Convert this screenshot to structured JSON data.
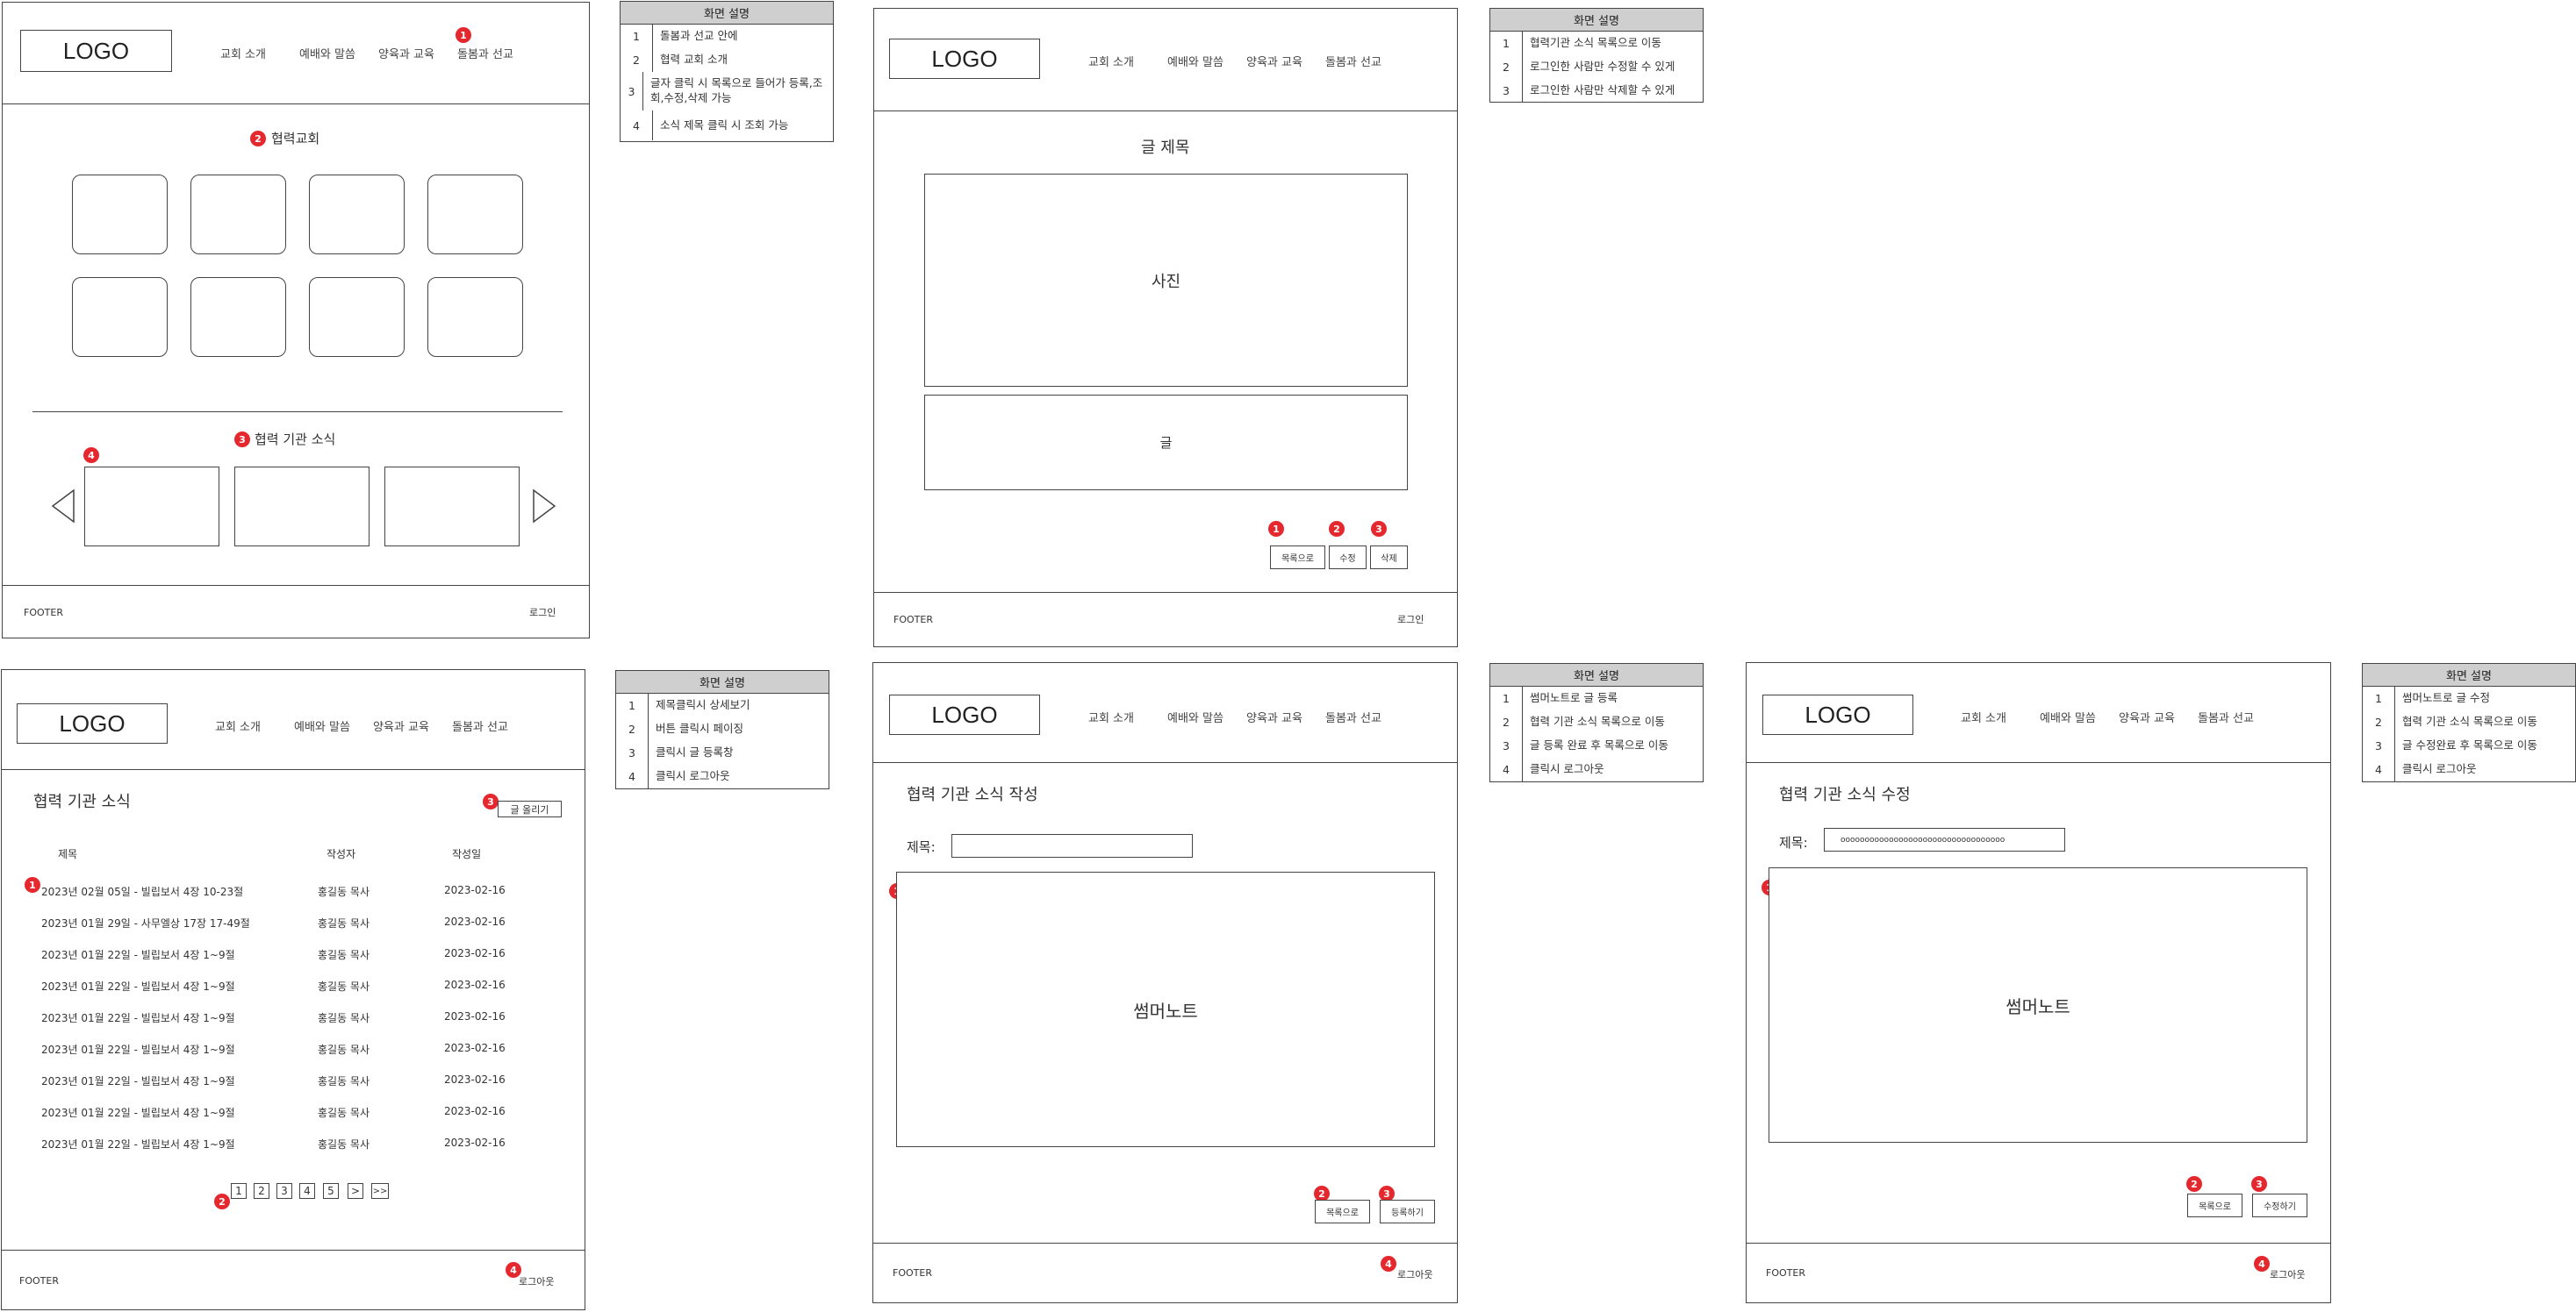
{
  "nav": {
    "about": "교회 소개",
    "worship": "예배와 말씀",
    "nurture": "양육과 교육",
    "mission": "돌봄과 선교"
  },
  "logo": "LOGO",
  "footer": {
    "label": "FOOTER",
    "login": "로그인",
    "logout": "로그아웃"
  },
  "badges": {
    "b1": "1",
    "b2": "2",
    "b3": "3",
    "b4": "4"
  },
  "screen1": {
    "section_partner": "협력교회",
    "section_news": "협력 기관 소식"
  },
  "desc_title": "화면 설명",
  "desc1": [
    {
      "n": "1",
      "t": "돌봄과 선교 안에"
    },
    {
      "n": "2",
      "t": "협력 교회 소개"
    },
    {
      "n": "3",
      "t": "글자 클릭 시 목록으로 들어가 등록,조회,수정,삭제 가능"
    },
    {
      "n": "4",
      "t": "소식 제목 클릭 시 조회 가능"
    }
  ],
  "screen2": {
    "post_title": "글 제목",
    "photo": "사진",
    "body": "글",
    "btn_list": "목록으로",
    "btn_edit": "수정",
    "btn_delete": "삭제"
  },
  "desc2": [
    {
      "n": "1",
      "t": "협력기관 소식 목록으로 이동"
    },
    {
      "n": "2",
      "t": "로그인한 사람만 수정할 수 있게"
    },
    {
      "n": "3",
      "t": "로그인한 사람만 삭제할 수 있게"
    }
  ],
  "screen3": {
    "page_title": "협력 기관 소식",
    "write_btn": "글 올리기",
    "col_title": "제목",
    "col_author": "작성자",
    "col_date": "작성일",
    "rows": [
      {
        "title": "2023년 02월 05일 - 빌립보서 4장 10-23절",
        "author": "홍길동 목사",
        "date": "2023-02-16"
      },
      {
        "title": "2023년 01월 29일 - 사무엘상 17장 17-49절",
        "author": "홍길동 목사",
        "date": "2023-02-16"
      },
      {
        "title": "2023년 01월 22일 - 빌립보서 4장 1~9절",
        "author": "홍길동 목사",
        "date": "2023-02-16"
      },
      {
        "title": "2023년 01월 22일 - 빌립보서 4장 1~9절",
        "author": "홍길동 목사",
        "date": "2023-02-16"
      },
      {
        "title": "2023년 01월 22일 - 빌립보서 4장 1~9절",
        "author": "홍길동 목사",
        "date": "2023-02-16"
      },
      {
        "title": "2023년 01월 22일 - 빌립보서 4장 1~9절",
        "author": "홍길동 목사",
        "date": "2023-02-16"
      },
      {
        "title": "2023년 01월 22일 - 빌립보서 4장 1~9절",
        "author": "홍길동 목사",
        "date": "2023-02-16"
      },
      {
        "title": "2023년 01월 22일 - 빌립보서 4장 1~9절",
        "author": "홍길동 목사",
        "date": "2023-02-16"
      },
      {
        "title": "2023년 01월 22일 - 빌립보서 4장 1~9절",
        "author": "홍길동 목사",
        "date": "2023-02-16"
      }
    ],
    "pages": [
      "1",
      "2",
      "3",
      "4",
      "5",
      ">",
      ">>"
    ]
  },
  "desc3": [
    {
      "n": "1",
      "t": "제목클릭시 상세보기"
    },
    {
      "n": "2",
      "t": "버튼 클릭시 페이징"
    },
    {
      "n": "3",
      "t": "클릭시 글 등록창"
    },
    {
      "n": "4",
      "t": "클릭시 로그아웃"
    }
  ],
  "screen4": {
    "page_title": "협력 기관 소식 작성",
    "title_label": "제목:",
    "title_value": "",
    "editor": "썸머노트",
    "btn_list": "목록으로",
    "btn_submit": "등록하기"
  },
  "desc4": [
    {
      "n": "1",
      "t": "썸머노트로 글 등록"
    },
    {
      "n": "2",
      "t": "협력 기관 소식 목록으로 이동"
    },
    {
      "n": "3",
      "t": "글 등록 완료 후 목록으로 이동"
    },
    {
      "n": "4",
      "t": "클릭시 로그아웃"
    }
  ],
  "screen5": {
    "page_title": "협력 기관 소식 수정",
    "title_label": "제목:",
    "title_value": "oooooooooooooooooooooooooooooooooo",
    "editor": "썸머노트",
    "btn_list": "목록으로",
    "btn_submit": "수정하기"
  },
  "desc5": [
    {
      "n": "1",
      "t": "썸머노트로 글 수정"
    },
    {
      "n": "2",
      "t": "협력 기관 소식 목록으로 이동"
    },
    {
      "n": "3",
      "t": "글 수정완료 후 목록으로 이동"
    },
    {
      "n": "4",
      "t": "클릭시 로그아웃"
    }
  ]
}
